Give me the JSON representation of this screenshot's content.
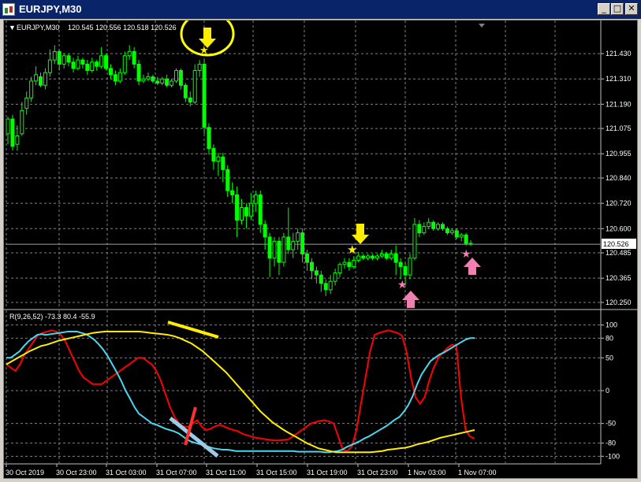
{
  "window": {
    "title": "EURJPY,M30",
    "minimize_glyph": "_",
    "maximize_glyph": "□",
    "close_glyph": "✕"
  },
  "chart_header": {
    "symbol": "EURJPY,M30",
    "ohlc": "120.545 120.556 120.518 120.526",
    "arrow_glyph": "▼"
  },
  "indicator_header": "R(9,26,52) -73.3 80.4 -55.9",
  "current_price": "120.526",
  "colors": {
    "background": "#000000",
    "bull_candle": "#00ff00",
    "grid": "#808080",
    "red_line": "#ff0000",
    "cyan_line": "#4ad7f0",
    "yellow_line": "#ffee00",
    "annotation_yellow": "#ffff00",
    "annotation_pink": "#f080b0",
    "annotation_red": "#ff3030",
    "annotation_lightblue": "#9ecbe8"
  },
  "chart_data": [
    {
      "type": "candlestick",
      "symbol": "EURJPY,M30",
      "ylim": [
        120.22,
        121.52
      ],
      "y_ticks": [
        "121.430",
        "121.310",
        "121.190",
        "121.075",
        "120.955",
        "120.840",
        "120.720",
        "120.600",
        "120.485",
        "120.365",
        "120.250"
      ],
      "x_ticks": [
        "30 Oct 2019",
        "30 Oct 23:00",
        "31 Oct 03:00",
        "31 Oct 07:00",
        "31 Oct 11:00",
        "31 Oct 15:00",
        "31 Oct 19:00",
        "31 Oct 23:00",
        "1 Nov 03:00",
        "1 Nov 07:00"
      ],
      "current_price": 120.526,
      "grid": true,
      "candles": [
        [
          121.05,
          121.12,
          121.13,
          121.0
        ],
        [
          121.12,
          120.99,
          121.14,
          120.97
        ],
        [
          121.0,
          121.04,
          121.09,
          120.97
        ],
        [
          121.05,
          121.16,
          121.2,
          121.04
        ],
        [
          121.17,
          121.22,
          121.25,
          121.14
        ],
        [
          121.22,
          121.3,
          121.32,
          121.2
        ],
        [
          121.3,
          121.33,
          121.37,
          121.28
        ],
        [
          121.32,
          121.28,
          121.34,
          121.27
        ],
        [
          121.28,
          121.34,
          121.36,
          121.26
        ],
        [
          121.34,
          121.4,
          121.45,
          121.32
        ],
        [
          121.4,
          121.44,
          121.47,
          121.38
        ],
        [
          121.44,
          121.38,
          121.45,
          121.35
        ],
        [
          121.38,
          121.42,
          121.43,
          121.36
        ],
        [
          121.42,
          121.39,
          121.43,
          121.37
        ],
        [
          121.39,
          121.36,
          121.41,
          121.34
        ],
        [
          121.36,
          121.4,
          121.42,
          121.35
        ],
        [
          121.4,
          121.38,
          121.41,
          121.36
        ],
        [
          121.38,
          121.35,
          121.4,
          121.33
        ],
        [
          121.35,
          121.39,
          121.41,
          121.34
        ],
        [
          121.39,
          121.37,
          121.4,
          121.35
        ],
        [
          121.37,
          121.42,
          121.46,
          121.36
        ],
        [
          121.42,
          121.36,
          121.43,
          121.35
        ],
        [
          121.36,
          121.33,
          121.38,
          121.31
        ],
        [
          121.33,
          121.3,
          121.35,
          121.28
        ],
        [
          121.3,
          121.34,
          121.36,
          121.29
        ],
        [
          121.34,
          121.42,
          121.44,
          121.33
        ],
        [
          121.42,
          121.44,
          121.47,
          121.4
        ],
        [
          121.44,
          121.38,
          121.46,
          121.36
        ],
        [
          121.38,
          121.3,
          121.4,
          121.28
        ],
        [
          121.3,
          121.31,
          121.33,
          121.29
        ],
        [
          121.31,
          121.32,
          121.34,
          121.3
        ],
        [
          121.32,
          121.3,
          121.33,
          121.29
        ],
        [
          121.3,
          121.29,
          121.32,
          121.28
        ],
        [
          121.29,
          121.31,
          121.32,
          121.28
        ],
        [
          121.31,
          121.28,
          121.33,
          121.27
        ],
        [
          121.28,
          121.3,
          121.31,
          121.27
        ],
        [
          121.3,
          121.35,
          121.36,
          121.29
        ],
        [
          121.35,
          121.28,
          121.36,
          121.26
        ],
        [
          121.28,
          121.22,
          121.29,
          121.2
        ],
        [
          121.22,
          121.2,
          121.25,
          121.18
        ],
        [
          121.2,
          121.35,
          121.38,
          121.19
        ],
        [
          121.35,
          121.38,
          121.4,
          121.32
        ],
        [
          121.38,
          121.08,
          121.4,
          121.05
        ],
        [
          121.08,
          120.98,
          121.1,
          120.95
        ],
        [
          120.98,
          120.92,
          121.0,
          120.88
        ],
        [
          120.92,
          120.94,
          120.96,
          120.85
        ],
        [
          120.94,
          120.88,
          120.96,
          120.82
        ],
        [
          120.88,
          120.78,
          120.9,
          120.75
        ],
        [
          120.78,
          120.76,
          120.82,
          120.72
        ],
        [
          120.76,
          120.64,
          120.8,
          120.56
        ],
        [
          120.64,
          120.7,
          120.74,
          120.62
        ],
        [
          120.7,
          120.66,
          120.72,
          120.6
        ],
        [
          120.66,
          120.72,
          120.77,
          120.64
        ],
        [
          120.72,
          120.76,
          120.78,
          120.68
        ],
        [
          120.76,
          120.62,
          120.78,
          120.58
        ],
        [
          120.62,
          120.56,
          120.64,
          120.5
        ],
        [
          120.56,
          120.46,
          120.58,
          120.37
        ],
        [
          120.46,
          120.54,
          120.56,
          120.42
        ],
        [
          120.54,
          120.44,
          120.56,
          120.38
        ],
        [
          120.44,
          120.56,
          120.58,
          120.42
        ],
        [
          120.56,
          120.5,
          120.7,
          120.48
        ],
        [
          120.5,
          120.54,
          120.58,
          120.46
        ],
        [
          120.54,
          120.58,
          120.6,
          120.5
        ],
        [
          120.58,
          120.48,
          120.6,
          120.44
        ],
        [
          120.48,
          120.44,
          120.5,
          120.4
        ],
        [
          120.44,
          120.4,
          120.46,
          120.36
        ],
        [
          120.4,
          120.38,
          120.42,
          120.34
        ],
        [
          120.38,
          120.34,
          120.4,
          120.3
        ],
        [
          120.34,
          120.31,
          120.36,
          120.28
        ],
        [
          120.31,
          120.35,
          120.38,
          120.29
        ],
        [
          120.35,
          120.39,
          120.41,
          120.33
        ],
        [
          120.39,
          120.43,
          120.44,
          120.37
        ],
        [
          120.43,
          120.44,
          120.46,
          120.41
        ],
        [
          120.44,
          120.42,
          120.46,
          120.4
        ],
        [
          120.42,
          120.45,
          120.47,
          120.41
        ],
        [
          120.45,
          120.47,
          120.49,
          120.44
        ],
        [
          120.47,
          120.46,
          120.48,
          120.45
        ],
        [
          120.46,
          120.47,
          120.48,
          120.45
        ],
        [
          120.47,
          120.46,
          120.48,
          120.45
        ],
        [
          120.46,
          120.47,
          120.48,
          120.45
        ],
        [
          120.47,
          120.48,
          120.5,
          120.46
        ],
        [
          120.48,
          120.46,
          120.49,
          120.45
        ],
        [
          120.46,
          120.48,
          120.5,
          120.45
        ],
        [
          120.48,
          120.44,
          120.52,
          120.38
        ],
        [
          120.44,
          120.42,
          120.46,
          120.36
        ],
        [
          120.42,
          120.38,
          120.44,
          120.33
        ],
        [
          120.38,
          120.46,
          120.48,
          120.36
        ],
        [
          120.46,
          120.62,
          120.65,
          120.45
        ],
        [
          120.62,
          120.58,
          120.64,
          120.56
        ],
        [
          120.58,
          120.61,
          120.63,
          120.57
        ],
        [
          120.61,
          120.63,
          120.65,
          120.6
        ],
        [
          120.63,
          120.6,
          120.64,
          120.59
        ],
        [
          120.6,
          120.62,
          120.63,
          120.59
        ],
        [
          120.62,
          120.6,
          120.63,
          120.59
        ],
        [
          120.6,
          120.58,
          120.61,
          120.57
        ],
        [
          120.58,
          120.59,
          120.6,
          120.57
        ],
        [
          120.59,
          120.56,
          120.6,
          120.55
        ],
        [
          120.56,
          120.57,
          120.58,
          120.54
        ],
        [
          120.57,
          120.53,
          120.58,
          120.52
        ],
        [
          120.53,
          120.53,
          120.545,
          120.518
        ]
      ]
    },
    {
      "type": "line",
      "header": "R(9,26,52) -73.3 80.4 -55.9",
      "ylim": [
        -108,
        108
      ],
      "y_ticks": [
        100,
        80,
        50,
        0,
        -50,
        -80,
        -100
      ],
      "series": [
        {
          "color": "#ff0000",
          "values": [
            40,
            35,
            30,
            40,
            55,
            65,
            75,
            85,
            88,
            90,
            92,
            90,
            85,
            75,
            60,
            45,
            30,
            20,
            15,
            10,
            10,
            10,
            15,
            20,
            25,
            30,
            35,
            40,
            45,
            50,
            50,
            45,
            40,
            30,
            15,
            -5,
            -25,
            -40,
            -50,
            -55,
            -55,
            -50,
            -45,
            -55,
            -60,
            -58,
            -54,
            -52,
            -55,
            -58,
            -60,
            -62,
            -66,
            -68,
            -70,
            -72,
            -73,
            -74,
            -75,
            -76,
            -76,
            -75,
            -74,
            -70,
            -65,
            -60,
            -55,
            -50,
            -48,
            -46,
            -45,
            -47,
            -50,
            -70,
            -90,
            -92,
            -85,
            -60,
            -20,
            20,
            60,
            85,
            88,
            90,
            92,
            90,
            88,
            84,
            60,
            20,
            -10,
            -20,
            -10,
            15,
            35,
            50,
            58,
            65,
            70,
            68,
            -10,
            -60,
            -70,
            -73
          ]
        },
        {
          "color": "#4ad7f0",
          "values": [
            50,
            50,
            55,
            60,
            68,
            75,
            80,
            85,
            86,
            85,
            86,
            87,
            88,
            89,
            90,
            90,
            90,
            88,
            86,
            82,
            77,
            70,
            62,
            52,
            40,
            28,
            15,
            0,
            -12,
            -25,
            -35,
            -40,
            -45,
            -50,
            -52,
            -55,
            -58,
            -60,
            -62,
            -65,
            -70,
            -75,
            -78,
            -80,
            -82,
            -84,
            -86,
            -88,
            -89,
            -90,
            -90,
            -91,
            -92,
            -92,
            -92,
            -92,
            -92,
            -92,
            -92,
            -92,
            -92,
            -92,
            -92,
            -92,
            -92,
            -92,
            -93,
            -93,
            -93,
            -93,
            -93,
            -93,
            -94,
            -94,
            -93,
            -92,
            -90,
            -86,
            -83,
            -80,
            -77,
            -73,
            -70,
            -66,
            -62,
            -58,
            -54,
            -49,
            -44,
            -40,
            -32,
            -22,
            -8,
            10,
            25,
            35,
            45,
            50,
            55,
            58,
            62,
            66,
            70,
            74,
            78,
            80,
            80
          ]
        },
        {
          "color": "#ffee00",
          "values": [
            40,
            45,
            50,
            55,
            60,
            64,
            68,
            70,
            73,
            76,
            78,
            80,
            82,
            84,
            86,
            88,
            89,
            90,
            90,
            90,
            90,
            90,
            90,
            90,
            89,
            88,
            87,
            86,
            85,
            83,
            80,
            76,
            72,
            66,
            60,
            52,
            44,
            36,
            28,
            18,
            8,
            -2,
            -12,
            -22,
            -32,
            -40,
            -48,
            -54,
            -60,
            -65,
            -70,
            -75,
            -80,
            -84,
            -88,
            -90,
            -92,
            -94,
            -94,
            -94,
            -94,
            -94,
            -94,
            -94,
            -93,
            -92,
            -90,
            -89,
            -88,
            -87,
            -85,
            -82,
            -80,
            -78,
            -75,
            -72,
            -70,
            -68,
            -66,
            -64,
            -62,
            -60
          ]
        }
      ]
    }
  ]
}
